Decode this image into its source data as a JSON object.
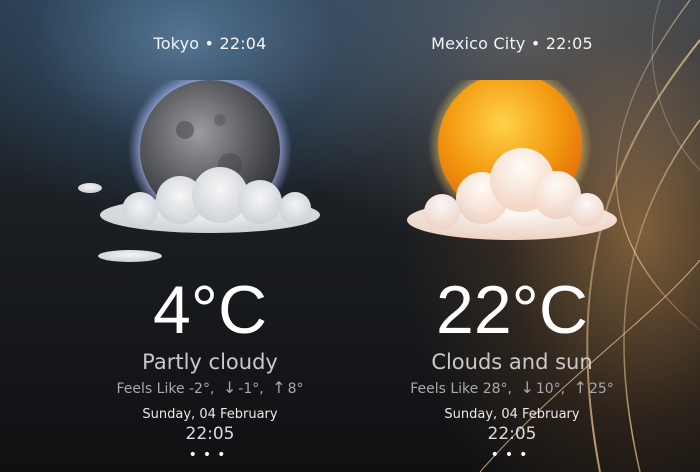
{
  "colors": {
    "sun_core": "#f39a10",
    "moon_glow": "#b9c6ff",
    "text_primary": "#ffffff",
    "text_secondary": "#a9a9ab"
  },
  "cities": [
    {
      "location": "Tokyo • 22:04",
      "icon": "moon-behind-cloud-icon",
      "temperature": "4°C",
      "condition": "Partly cloudy",
      "feels_label": "Feels Like -2°,",
      "low": "-1°,",
      "high": "8°",
      "date": "Sunday, 04 February",
      "time": "22:05",
      "more": "•••"
    },
    {
      "location": "Mexico City • 22:05",
      "icon": "sun-behind-cloud-icon",
      "temperature": "22°C",
      "condition": "Clouds and sun",
      "feels_label": "Feels Like 28°,",
      "low": "10°,",
      "high": "25°",
      "date": "Sunday, 04 February",
      "time": "22:05",
      "more": "•••"
    }
  ],
  "arrows": {
    "down": "↓",
    "up": "↑"
  }
}
